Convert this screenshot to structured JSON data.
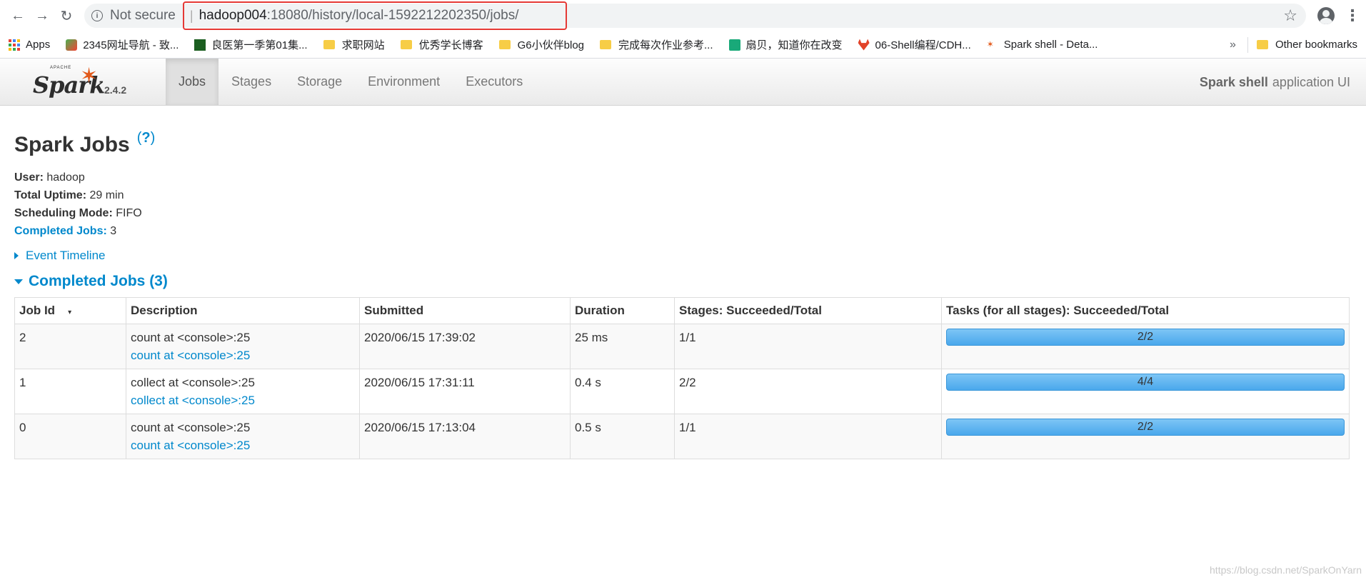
{
  "browser": {
    "not_secure": "Not secure",
    "url_host": "hadoop004",
    "url_path": ":18080/history/local-1592212202350/jobs/",
    "bookmarks": [
      {
        "label": "Apps",
        "icon": "apps-icon"
      },
      {
        "label": "2345网址导航 - 致...",
        "icon": "site-icon"
      },
      {
        "label": "良医第一季第01集...",
        "icon": "video-icon"
      },
      {
        "label": "求职网站",
        "icon": "folder-icon"
      },
      {
        "label": "优秀学长博客",
        "icon": "folder-icon"
      },
      {
        "label": "G6小伙伴blog",
        "icon": "folder-icon"
      },
      {
        "label": "完成每次作业参考...",
        "icon": "folder-icon"
      },
      {
        "label": "扇贝，知道你在改变",
        "icon": "shanbay-icon"
      },
      {
        "label": "06-Shell编程/CDH...",
        "icon": "gitlab-icon"
      },
      {
        "label": "Spark shell - Deta...",
        "icon": "spark-icon"
      }
    ],
    "more": "»",
    "other_bookmarks": "Other bookmarks"
  },
  "navbar": {
    "logo_apache": "APACHE",
    "logo_word": "Spark",
    "version": "2.4.2",
    "tabs": [
      "Jobs",
      "Stages",
      "Storage",
      "Environment",
      "Executors"
    ],
    "active_tab": "Jobs",
    "app_name": "Spark shell",
    "app_suffix": "application UI"
  },
  "page": {
    "title": "Spark Jobs",
    "help": "?",
    "user_label": "User:",
    "user": "hadoop",
    "uptime_label": "Total Uptime:",
    "uptime": "29 min",
    "mode_label": "Scheduling Mode:",
    "mode": "FIFO",
    "completed_label": "Completed Jobs:",
    "completed": "3",
    "event_timeline": "Event Timeline",
    "section_title": "Completed Jobs (3)"
  },
  "table": {
    "headers": [
      "Job Id",
      "Description",
      "Submitted",
      "Duration",
      "Stages: Succeeded/Total",
      "Tasks (for all stages): Succeeded/Total"
    ],
    "sort_icon": "▾",
    "rows": [
      {
        "id": "2",
        "desc": "count at <console>:25",
        "desc_link": "count at <console>:25",
        "submitted": "2020/06/15 17:39:02",
        "duration": "25 ms",
        "stages": "1/1",
        "tasks": "2/2",
        "tasks_progress": 1.0
      },
      {
        "id": "1",
        "desc": "collect at <console>:25",
        "desc_link": "collect at <console>:25",
        "submitted": "2020/06/15 17:31:11",
        "duration": "0.4 s",
        "stages": "2/2",
        "tasks": "4/4",
        "tasks_progress": 1.0
      },
      {
        "id": "0",
        "desc": "count at <console>:25",
        "desc_link": "count at <console>:25",
        "submitted": "2020/06/15 17:13:04",
        "duration": "0.5 s",
        "stages": "1/1",
        "tasks": "2/2",
        "tasks_progress": 1.0
      }
    ]
  },
  "watermark": "https://blog.csdn.net/SparkOnYarn",
  "colors": {
    "link": "#0088cc",
    "progress": "#4aa8ec",
    "highlight": "#e53935"
  }
}
